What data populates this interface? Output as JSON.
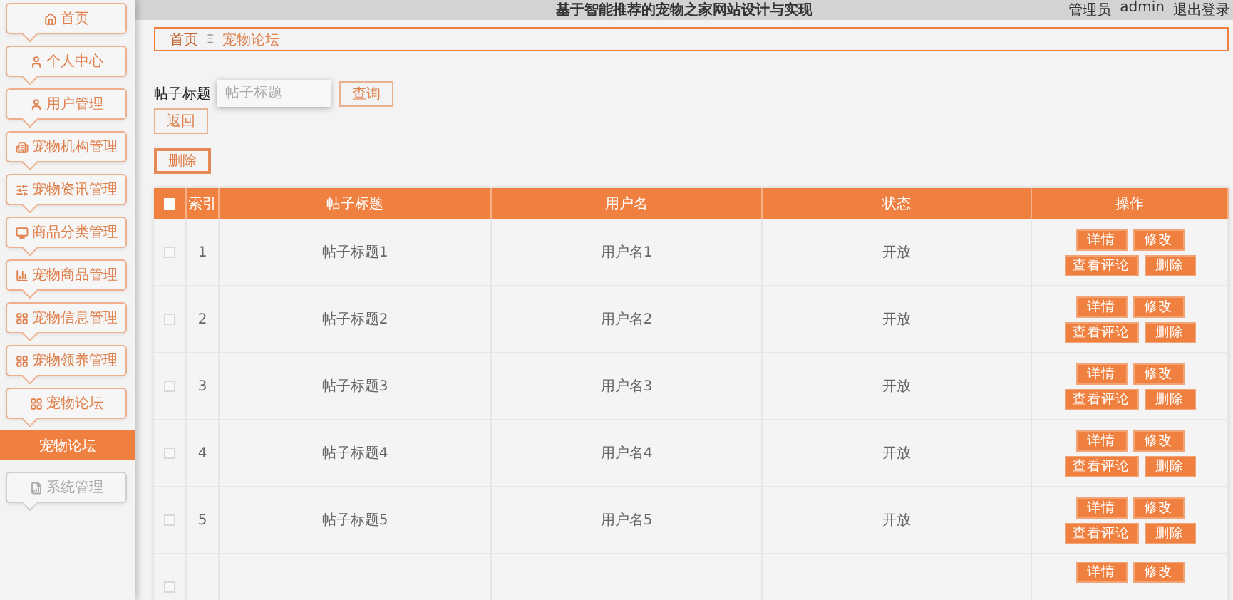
{
  "sidebar": {
    "items": [
      {
        "label": "首页",
        "disabled": false
      },
      {
        "label": "个人中心",
        "disabled": false
      },
      {
        "label": "用户管理",
        "disabled": false
      },
      {
        "label": "宠物机构管理",
        "disabled": false
      },
      {
        "label": "宠物资讯管理",
        "disabled": false
      },
      {
        "label": "商品分类管理",
        "disabled": false
      },
      {
        "label": "宠物商品管理",
        "disabled": false
      },
      {
        "label": "宠物信息管理",
        "disabled": false
      },
      {
        "label": "宠物领养管理",
        "disabled": false
      },
      {
        "label": "宠物论坛",
        "disabled": false,
        "children": [
          {
            "label": "宠物论坛",
            "selected": true
          }
        ]
      },
      {
        "label": "系统管理",
        "disabled": true
      }
    ]
  },
  "header": {
    "title": "基于智能推荐的宠物之家网站设计与实现",
    "role": "管理员",
    "user": "admin",
    "logout": "退出登录"
  },
  "breadcrumb": {
    "items": [
      "首页",
      "宠物论坛"
    ],
    "separator": "Ξ"
  },
  "search": {
    "label": "帖子标题",
    "placeholder": "帖子标题",
    "button": "查询"
  },
  "back_button": "返回",
  "delete_button": "删除",
  "table": {
    "select_all_checked": false,
    "columns": [
      "索引",
      "帖子标题",
      "用户名",
      "状态",
      "操作"
    ],
    "rows": [
      {
        "index": "1",
        "title": "帖子标题1",
        "user": "用户名1",
        "status": "开放",
        "checked": false,
        "actions": [
          "详情",
          "修改",
          "查看评论",
          "删除"
        ]
      },
      {
        "index": "2",
        "title": "帖子标题2",
        "user": "用户名2",
        "status": "开放",
        "checked": false,
        "actions": [
          "详情",
          "修改",
          "查看评论",
          "删除"
        ]
      },
      {
        "index": "3",
        "title": "帖子标题3",
        "user": "用户名3",
        "status": "开放",
        "checked": false,
        "actions": [
          "详情",
          "修改",
          "查看评论",
          "删除"
        ]
      },
      {
        "index": "4",
        "title": "帖子标题4",
        "user": "用户名4",
        "status": "开放",
        "checked": false,
        "actions": [
          "详情",
          "修改",
          "查看评论",
          "删除"
        ]
      },
      {
        "index": "5",
        "title": "帖子标题5",
        "user": "用户名5",
        "status": "开放",
        "checked": false,
        "actions": [
          "详情",
          "修改",
          "查看评论",
          "删除"
        ]
      },
      {
        "checked": false,
        "actions": [
          "详情",
          "修改"
        ]
      }
    ]
  }
}
